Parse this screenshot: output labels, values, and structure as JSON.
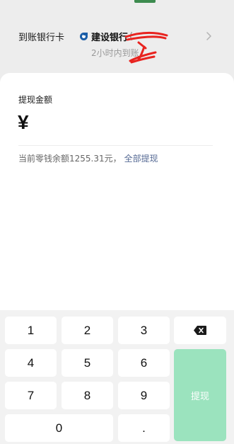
{
  "bank": {
    "label": "到账银行卡",
    "name": "建设银行",
    "name_tail": "(",
    "arrival_time": "2小时内到账"
  },
  "withdraw": {
    "amount_title": "提现金额",
    "currency_symbol": "¥",
    "balance_text": "当前零钱余额1255.31元，",
    "withdraw_all": "全部提现"
  },
  "keypad": {
    "keys": [
      "1",
      "2",
      "3",
      "4",
      "5",
      "6",
      "7",
      "8",
      "9",
      "0",
      "."
    ],
    "submit_label": "提现"
  },
  "colors": {
    "submit_bg": "#9be3be",
    "link": "#576b95",
    "bank_logo": "#1b5ea8"
  }
}
